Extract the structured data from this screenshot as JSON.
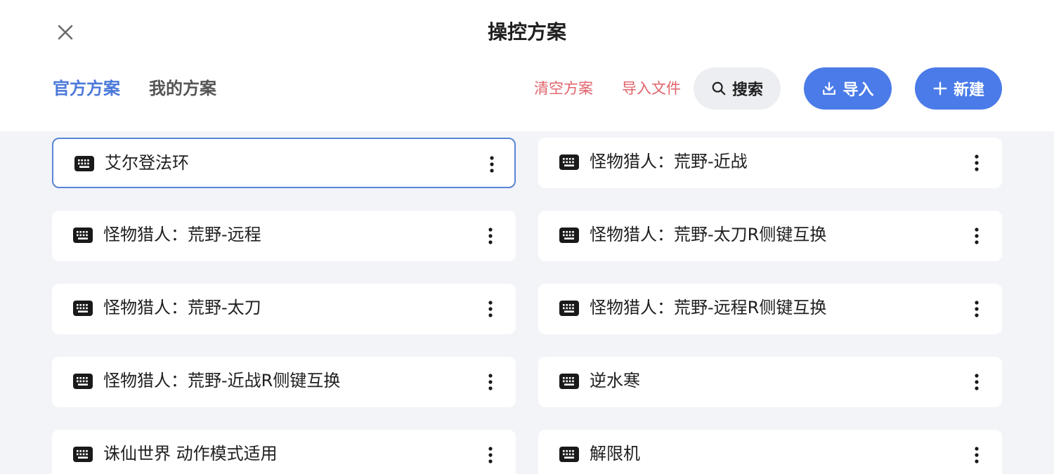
{
  "header": {
    "title": "操控方案",
    "close_icon": "close-icon"
  },
  "tabs": [
    {
      "label": "官方方案",
      "active": true
    },
    {
      "label": "我的方案",
      "active": false
    }
  ],
  "actions": {
    "clear_label": "清空方案",
    "import_file_label": "导入文件",
    "search_label": "搜索",
    "import_label": "导入",
    "new_label": "新建"
  },
  "colors": {
    "accent": "#4a7be8",
    "tab_active": "#4a78d9",
    "danger_text": "#e0636a",
    "content_bg": "#f3f4f8"
  },
  "schemes": [
    {
      "name": "艾尔登法环",
      "selected": true,
      "icon": "keyboard-icon"
    },
    {
      "name": "怪物猎人：荒野-近战",
      "selected": false,
      "icon": "keyboard-icon"
    },
    {
      "name": "怪物猎人：荒野-远程",
      "selected": false,
      "icon": "keyboard-icon"
    },
    {
      "name": "怪物猎人：荒野-太刀R侧键互换",
      "selected": false,
      "icon": "keyboard-icon"
    },
    {
      "name": "怪物猎人：荒野-太刀",
      "selected": false,
      "icon": "keyboard-icon"
    },
    {
      "name": "怪物猎人：荒野-远程R侧键互换",
      "selected": false,
      "icon": "keyboard-icon"
    },
    {
      "name": "怪物猎人：荒野-近战R侧键互换",
      "selected": false,
      "icon": "keyboard-icon"
    },
    {
      "name": "逆水寒",
      "selected": false,
      "icon": "keyboard-icon"
    },
    {
      "name": "诛仙世界 动作模式适用",
      "selected": false,
      "icon": "keyboard-icon"
    },
    {
      "name": "解限机",
      "selected": false,
      "icon": "keyboard-icon"
    }
  ]
}
